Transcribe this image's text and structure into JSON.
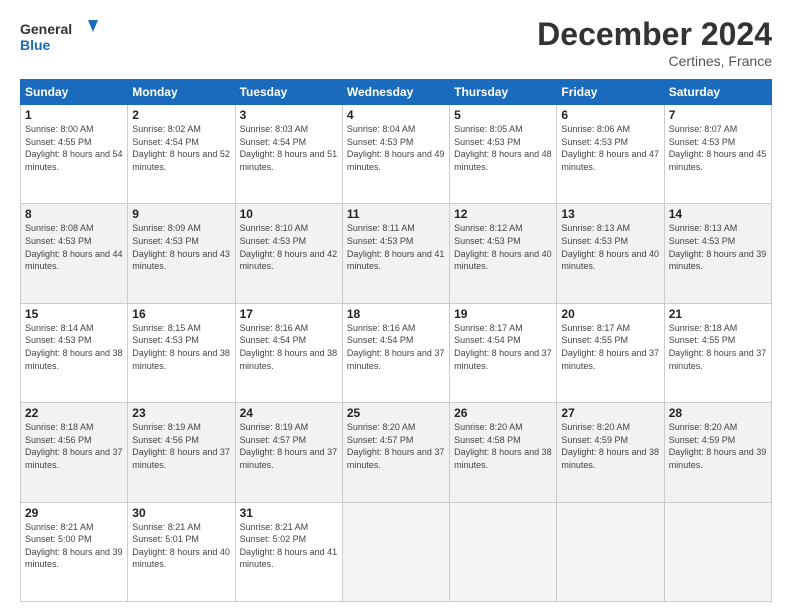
{
  "logo": {
    "line1": "General",
    "line2": "Blue"
  },
  "title": "December 2024",
  "subtitle": "Certines, France",
  "days_header": [
    "Sunday",
    "Monday",
    "Tuesday",
    "Wednesday",
    "Thursday",
    "Friday",
    "Saturday"
  ],
  "weeks": [
    [
      {
        "num": "1",
        "sunrise": "8:00 AM",
        "sunset": "4:55 PM",
        "daylight": "8 hours and 54 minutes."
      },
      {
        "num": "2",
        "sunrise": "8:02 AM",
        "sunset": "4:54 PM",
        "daylight": "8 hours and 52 minutes."
      },
      {
        "num": "3",
        "sunrise": "8:03 AM",
        "sunset": "4:54 PM",
        "daylight": "8 hours and 51 minutes."
      },
      {
        "num": "4",
        "sunrise": "8:04 AM",
        "sunset": "4:53 PM",
        "daylight": "8 hours and 49 minutes."
      },
      {
        "num": "5",
        "sunrise": "8:05 AM",
        "sunset": "4:53 PM",
        "daylight": "8 hours and 48 minutes."
      },
      {
        "num": "6",
        "sunrise": "8:06 AM",
        "sunset": "4:53 PM",
        "daylight": "8 hours and 47 minutes."
      },
      {
        "num": "7",
        "sunrise": "8:07 AM",
        "sunset": "4:53 PM",
        "daylight": "8 hours and 45 minutes."
      }
    ],
    [
      {
        "num": "8",
        "sunrise": "8:08 AM",
        "sunset": "4:53 PM",
        "daylight": "8 hours and 44 minutes."
      },
      {
        "num": "9",
        "sunrise": "8:09 AM",
        "sunset": "4:53 PM",
        "daylight": "8 hours and 43 minutes."
      },
      {
        "num": "10",
        "sunrise": "8:10 AM",
        "sunset": "4:53 PM",
        "daylight": "8 hours and 42 minutes."
      },
      {
        "num": "11",
        "sunrise": "8:11 AM",
        "sunset": "4:53 PM",
        "daylight": "8 hours and 41 minutes."
      },
      {
        "num": "12",
        "sunrise": "8:12 AM",
        "sunset": "4:53 PM",
        "daylight": "8 hours and 40 minutes."
      },
      {
        "num": "13",
        "sunrise": "8:13 AM",
        "sunset": "4:53 PM",
        "daylight": "8 hours and 40 minutes."
      },
      {
        "num": "14",
        "sunrise": "8:13 AM",
        "sunset": "4:53 PM",
        "daylight": "8 hours and 39 minutes."
      }
    ],
    [
      {
        "num": "15",
        "sunrise": "8:14 AM",
        "sunset": "4:53 PM",
        "daylight": "8 hours and 38 minutes."
      },
      {
        "num": "16",
        "sunrise": "8:15 AM",
        "sunset": "4:53 PM",
        "daylight": "8 hours and 38 minutes."
      },
      {
        "num": "17",
        "sunrise": "8:16 AM",
        "sunset": "4:54 PM",
        "daylight": "8 hours and 38 minutes."
      },
      {
        "num": "18",
        "sunrise": "8:16 AM",
        "sunset": "4:54 PM",
        "daylight": "8 hours and 37 minutes."
      },
      {
        "num": "19",
        "sunrise": "8:17 AM",
        "sunset": "4:54 PM",
        "daylight": "8 hours and 37 minutes."
      },
      {
        "num": "20",
        "sunrise": "8:17 AM",
        "sunset": "4:55 PM",
        "daylight": "8 hours and 37 minutes."
      },
      {
        "num": "21",
        "sunrise": "8:18 AM",
        "sunset": "4:55 PM",
        "daylight": "8 hours and 37 minutes."
      }
    ],
    [
      {
        "num": "22",
        "sunrise": "8:18 AM",
        "sunset": "4:56 PM",
        "daylight": "8 hours and 37 minutes."
      },
      {
        "num": "23",
        "sunrise": "8:19 AM",
        "sunset": "4:56 PM",
        "daylight": "8 hours and 37 minutes."
      },
      {
        "num": "24",
        "sunrise": "8:19 AM",
        "sunset": "4:57 PM",
        "daylight": "8 hours and 37 minutes."
      },
      {
        "num": "25",
        "sunrise": "8:20 AM",
        "sunset": "4:57 PM",
        "daylight": "8 hours and 37 minutes."
      },
      {
        "num": "26",
        "sunrise": "8:20 AM",
        "sunset": "4:58 PM",
        "daylight": "8 hours and 38 minutes."
      },
      {
        "num": "27",
        "sunrise": "8:20 AM",
        "sunset": "4:59 PM",
        "daylight": "8 hours and 38 minutes."
      },
      {
        "num": "28",
        "sunrise": "8:20 AM",
        "sunset": "4:59 PM",
        "daylight": "8 hours and 39 minutes."
      }
    ],
    [
      {
        "num": "29",
        "sunrise": "8:21 AM",
        "sunset": "5:00 PM",
        "daylight": "8 hours and 39 minutes."
      },
      {
        "num": "30",
        "sunrise": "8:21 AM",
        "sunset": "5:01 PM",
        "daylight": "8 hours and 40 minutes."
      },
      {
        "num": "31",
        "sunrise": "8:21 AM",
        "sunset": "5:02 PM",
        "daylight": "8 hours and 41 minutes."
      },
      null,
      null,
      null,
      null
    ]
  ],
  "labels": {
    "sunrise": "Sunrise:",
    "sunset": "Sunset:",
    "daylight": "Daylight:"
  }
}
